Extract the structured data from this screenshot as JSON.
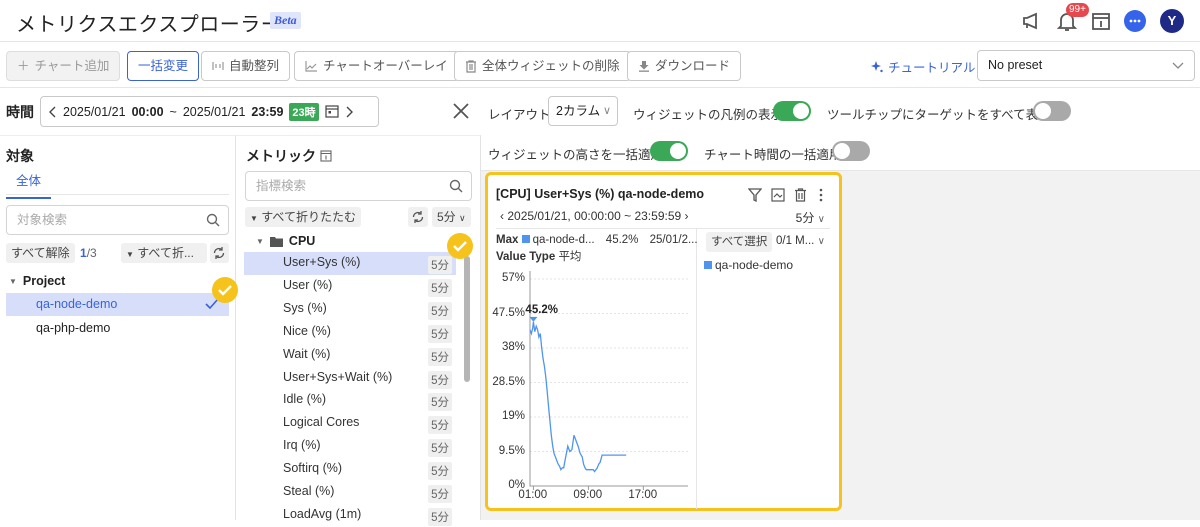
{
  "header": {
    "title": "メトリクスエクスプローラー",
    "beta_label": "Beta",
    "notification_count": "99+",
    "avatar_initial": "Y"
  },
  "toolbar": {
    "add_chart": "チャート追加",
    "bulk_change": "一括変更",
    "auto_arrange": "自動整列",
    "chart_overlay": "チャートオーバーレイ",
    "delete_all_widgets": "全体ウィジェットの削除",
    "download": "ダウンロード",
    "tutorial": "チュートリアル",
    "preset_value": "No preset"
  },
  "time": {
    "label": "時間",
    "start_date": "2025/01/21",
    "start_time": "00:00",
    "separator": "~",
    "end_date": "2025/01/21",
    "end_time": "23:59",
    "duration_badge": "23時"
  },
  "target": {
    "title": "対象",
    "tab_all": "全体",
    "search_placeholder": "対象検索",
    "clear_all": "すべて解除",
    "count_selected": "1",
    "count_total": "/3",
    "collapse_all": "すべて折...",
    "group": "Project",
    "items": [
      {
        "label": "qa-node-demo",
        "selected": true
      },
      {
        "label": "qa-php-demo",
        "selected": false
      }
    ]
  },
  "metric": {
    "title": "メトリック",
    "search_placeholder": "指標検索",
    "collapse_all": "すべて折りたたむ",
    "interval": "5分",
    "category": "CPU",
    "items": [
      {
        "label": "User+Sys (%)",
        "interval": "5分",
        "selected": true
      },
      {
        "label": "User (%)",
        "interval": "5分"
      },
      {
        "label": "Sys (%)",
        "interval": "5分"
      },
      {
        "label": "Nice (%)",
        "interval": "5分"
      },
      {
        "label": "Wait (%)",
        "interval": "5分"
      },
      {
        "label": "User+Sys+Wait (%)",
        "interval": "5分"
      },
      {
        "label": "Idle (%)",
        "interval": "5分"
      },
      {
        "label": "Logical Cores",
        "interval": "5分"
      },
      {
        "label": "Irq (%)",
        "interval": "5分"
      },
      {
        "label": "Softirq (%)",
        "interval": "5分"
      },
      {
        "label": "Steal (%)",
        "interval": "5分"
      },
      {
        "label": "LoadAvg (1m)",
        "interval": "5分"
      }
    ]
  },
  "options": {
    "layout_label": "レイアウト",
    "layout_value": "2カラム",
    "show_legend_label": "ウィジェットの凡例の表示",
    "show_legend": true,
    "tooltip_all_label": "ツールチップにターゲットをすべて表示",
    "tooltip_all": false,
    "bulk_height_label": "ウィジェットの高さを一括適用",
    "bulk_height": true,
    "bulk_time_label": "チャート時間の一括適用",
    "bulk_time": false
  },
  "widget": {
    "title": "[CPU] User+Sys (%) qa-node-demo",
    "range": "2025/01/21, 00:00:00 ~ 23:59:59",
    "interval": "5分",
    "summary_max_label": "Max",
    "summary_target": "qa-node-d...",
    "summary_value": "45.2%",
    "summary_time": "25/01/2...",
    "value_type_label": "Value Type",
    "value_type": "平均",
    "select_all": "すべて選択",
    "selection_count": "0/1 M...",
    "legend_item": "qa-node-demo",
    "series_color": "#4f95f0"
  },
  "chart_data": {
    "type": "line",
    "title": "[CPU] User+Sys (%) qa-node-demo",
    "xlabel": "",
    "ylabel": "",
    "y_ticks": [
      "0%",
      "9.5%",
      "19%",
      "28.5%",
      "38%",
      "47.5%",
      "57%"
    ],
    "ylim": [
      0,
      57
    ],
    "x_ticks": [
      "01:00",
      "09:00",
      "17:00"
    ],
    "xlim_hours": [
      0.5,
      23.5
    ],
    "max_annotation": {
      "label": "45.2%",
      "x_hour": 1.0,
      "y": 45.2
    },
    "grid": true,
    "series": [
      {
        "name": "qa-node-demo",
        "color": "#4f95f0",
        "x_hours": [
          0.5,
          0.7,
          0.9,
          1.0,
          1.2,
          1.4,
          1.6,
          1.8,
          2.0,
          2.2,
          2.4,
          2.6,
          2.8,
          3.0,
          3.2,
          3.4,
          3.6,
          3.8,
          4.0,
          4.2,
          4.4,
          4.6,
          4.8,
          5.0,
          5.2,
          5.4,
          5.6,
          5.8,
          6.0,
          6.3,
          6.6,
          6.9,
          7.2,
          7.5,
          7.8,
          8.1,
          8.3,
          8.5,
          8.7,
          8.9,
          9.1,
          9.3,
          9.5,
          9.7,
          9.9,
          10.1,
          10.3,
          10.5,
          10.7,
          11.0,
          11.4,
          11.8,
          12.2,
          12.6,
          13.0,
          13.3,
          13.6,
          13.9,
          14.2,
          14.5
        ],
        "values": [
          43,
          42,
          43.5,
          45.2,
          42.5,
          44,
          43,
          41,
          42,
          38,
          35,
          33,
          30,
          26,
          22,
          18,
          14,
          11,
          9,
          8,
          7,
          6,
          5.5,
          4.5,
          5,
          5,
          7,
          9,
          11,
          9.5,
          10,
          14,
          12.5,
          11,
          9,
          8,
          6,
          5,
          4.5,
          4.5,
          4.5,
          4.5,
          4.5,
          4.5,
          4,
          4.5,
          5,
          6,
          6.5,
          8.5,
          8.5,
          8.5,
          8.5,
          8.5,
          8.5,
          8.5,
          8.5,
          8.5,
          8.5,
          8.5
        ]
      }
    ]
  }
}
